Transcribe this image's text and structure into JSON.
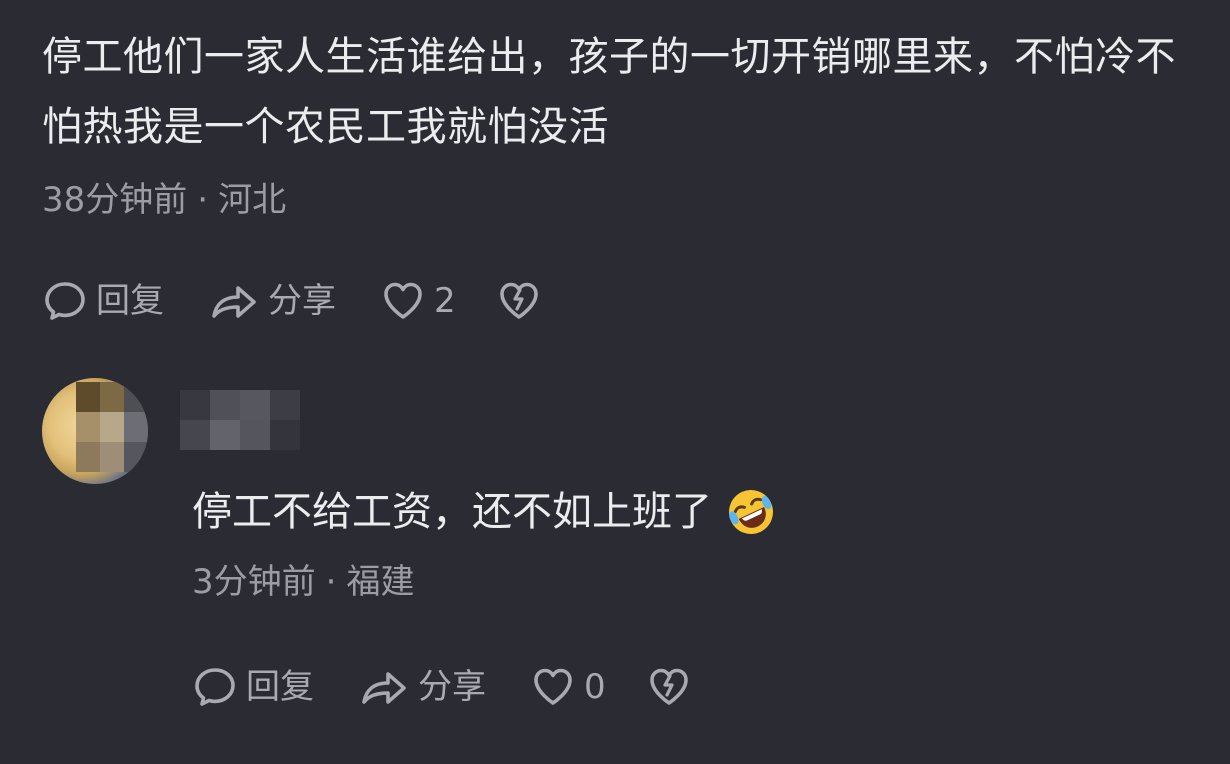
{
  "comment": {
    "text": "停工他们一家人生活谁给出，孩子的一切开销哪里来，不怕冷不怕热我是一个农民工我就怕没活",
    "time": "38分钟前",
    "location": "河北",
    "actions": {
      "reply_label": "回复",
      "share_label": "分享",
      "like_count": "2"
    }
  },
  "reply": {
    "username": "",
    "text": "停工不给工资，还不如上班了",
    "emoji": "rolling-on-floor-laughing-emoji",
    "time": "3分钟前",
    "location": "福建",
    "actions": {
      "reply_label": "回复",
      "share_label": "分享",
      "like_count": "0"
    }
  },
  "separator": "·",
  "colors": {
    "background": "#2b2c33",
    "text": "#ececef",
    "meta": "#9b9ca4",
    "icon": "#a9aab1"
  }
}
